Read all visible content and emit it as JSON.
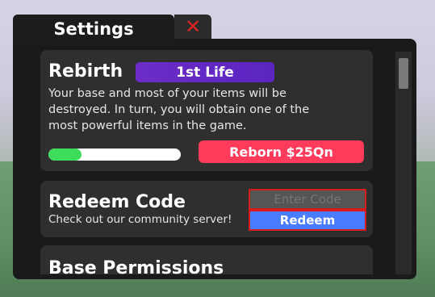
{
  "header": {
    "title": "Settings",
    "close_icon": "close-icon"
  },
  "rebirth": {
    "heading": "Rebirth",
    "badge": "1st Life",
    "description_lines": [
      "Your base and most of your items will be",
      "destroyed. In turn, you will obtain one of the",
      "most powerful items in the game."
    ],
    "progress_fraction": 0.25,
    "button_label": "Reborn $25Qn"
  },
  "redeem": {
    "heading": "Redeem Code",
    "subtext": "Check out our community server!",
    "input_placeholder": "Enter Code",
    "button_label": "Redeem"
  },
  "permissions": {
    "heading": "Base Permissions"
  },
  "colors": {
    "panel": "#1a1a1a",
    "card": "#2f2f2f",
    "accent_purple": "#5a25c0",
    "reborn": "#ff3b5c",
    "redeem": "#4a7cff",
    "progress": "#3ddc5a",
    "highlight": "#d81b1b"
  }
}
